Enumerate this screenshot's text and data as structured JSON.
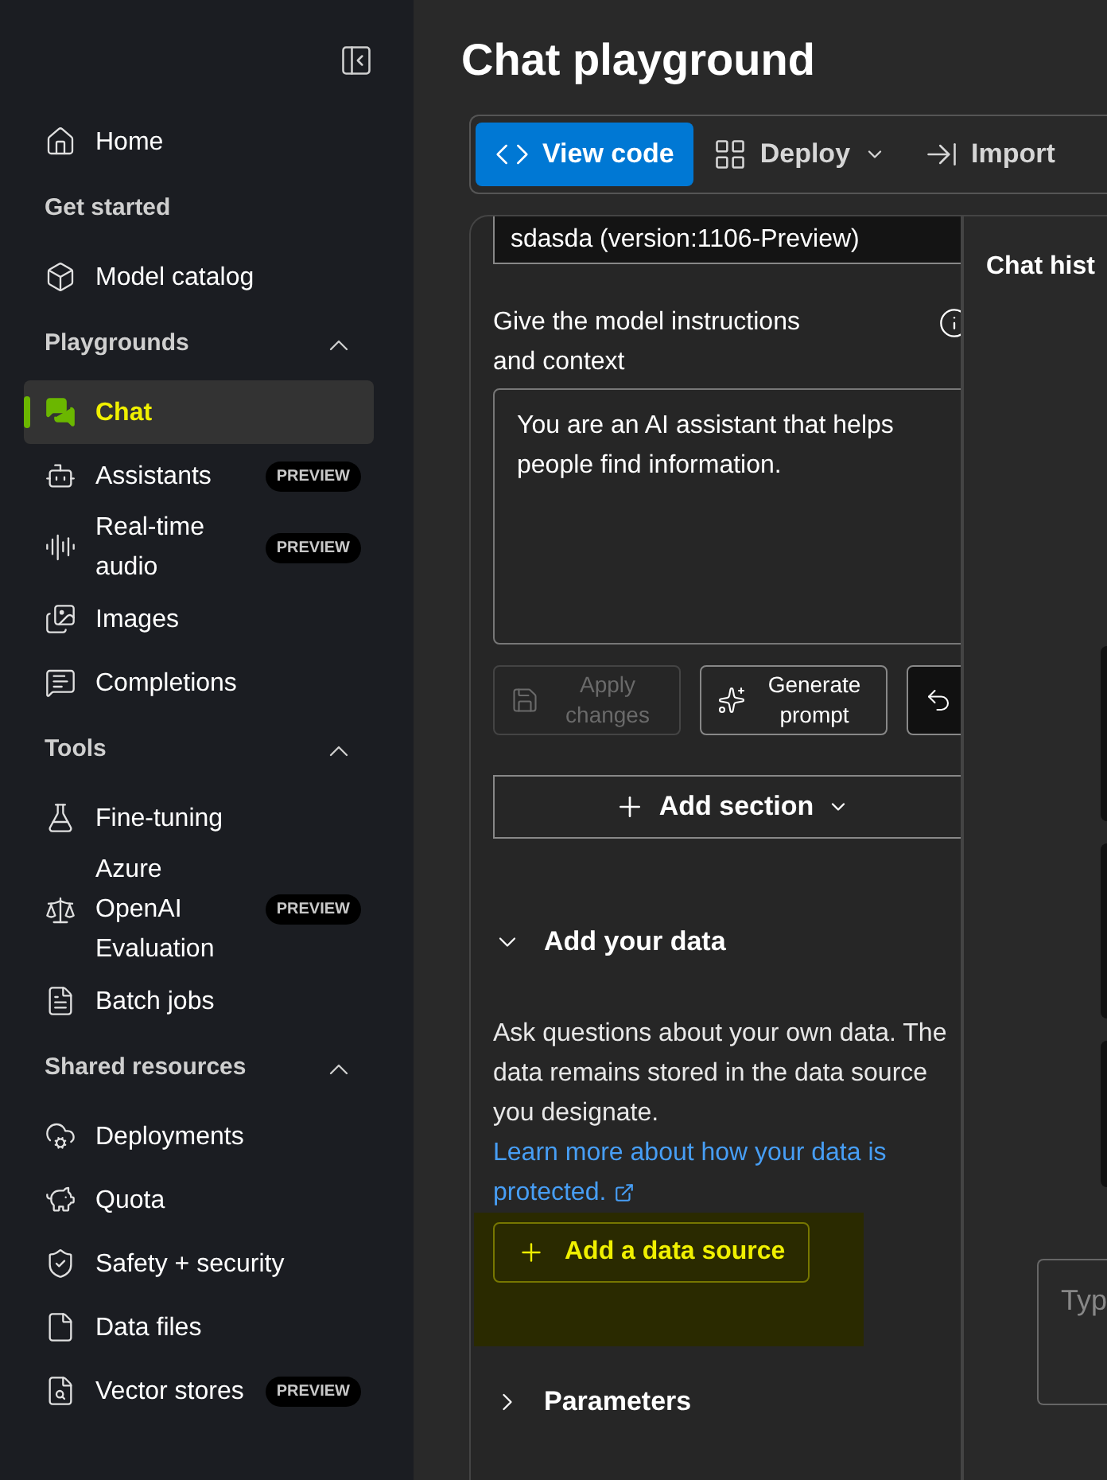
{
  "sidebar": {
    "items": [
      {
        "kind": "item",
        "label": "Home",
        "selected": false,
        "highlighted": false
      },
      {
        "kind": "section",
        "label": "Get started"
      },
      {
        "kind": "item",
        "label": "Model catalog",
        "selected": false,
        "highlighted": false
      },
      {
        "kind": "section",
        "label": "Playgrounds",
        "expanded": true
      },
      {
        "kind": "item",
        "label": "Chat",
        "selected": true,
        "highlighted": true
      },
      {
        "kind": "item",
        "label": "Assistants",
        "badge": "PREVIEW",
        "selected": false,
        "highlighted": false
      },
      {
        "kind": "item",
        "label": "Real-time audio",
        "badge": "PREVIEW",
        "selected": false,
        "highlighted": false
      },
      {
        "kind": "item",
        "label": "Images",
        "selected": false,
        "highlighted": false
      },
      {
        "kind": "item",
        "label": "Completions",
        "selected": false,
        "highlighted": false
      },
      {
        "kind": "section",
        "label": "Tools",
        "expanded": true
      },
      {
        "kind": "item",
        "label": "Fine-tuning",
        "selected": false,
        "highlighted": false
      },
      {
        "kind": "item",
        "label": "Azure OpenAI Evaluation",
        "badge": "PREVIEW",
        "selected": false,
        "highlighted": false
      },
      {
        "kind": "item",
        "label": "Batch jobs",
        "selected": false,
        "highlighted": false
      },
      {
        "kind": "section",
        "label": "Shared resources",
        "expanded": true
      },
      {
        "kind": "item",
        "label": "Deployments",
        "selected": false,
        "highlighted": false
      },
      {
        "kind": "item",
        "label": "Quota",
        "selected": false,
        "highlighted": false
      },
      {
        "kind": "item",
        "label": "Safety + security",
        "selected": false,
        "highlighted": false
      },
      {
        "kind": "item",
        "label": "Data files",
        "selected": false,
        "highlighted": false
      },
      {
        "kind": "item",
        "label": "Vector stores",
        "badge": "PREVIEW",
        "selected": false,
        "highlighted": false
      }
    ]
  },
  "page": {
    "title": "Chat playground"
  },
  "toolbar": [
    {
      "kind": "primary",
      "label": "View code",
      "caret": false
    },
    {
      "kind": "plain",
      "label": "Deploy",
      "caret": true
    },
    {
      "kind": "plain",
      "label": "Import",
      "caret": false
    }
  ],
  "setup": {
    "deployment_value": "sdasda (version:1106-Preview)",
    "instructions_label": "Give the model instructions and context",
    "instructions_value": "You are an AI assistant that helps people find information.",
    "buttons": [
      {
        "kind": "save",
        "label": "Apply changes",
        "disabled": true
      },
      {
        "kind": "sparkle",
        "label": "Generate prompt",
        "disabled": false
      },
      {
        "kind": "undo",
        "disabled": false
      }
    ],
    "add_section": "Add section",
    "sections": [
      {
        "title": "Add your data",
        "expanded": true,
        "description": "Ask questions about your own data. The data remains stored in the data source you designate.",
        "link": "Learn more about how your data is protected.",
        "action": "Add a data source",
        "action_highlighted": true
      },
      {
        "title": "Parameters",
        "expanded": false
      }
    ]
  },
  "chat": {
    "title": "Chat hist",
    "input_placeholder": "Typ"
  }
}
